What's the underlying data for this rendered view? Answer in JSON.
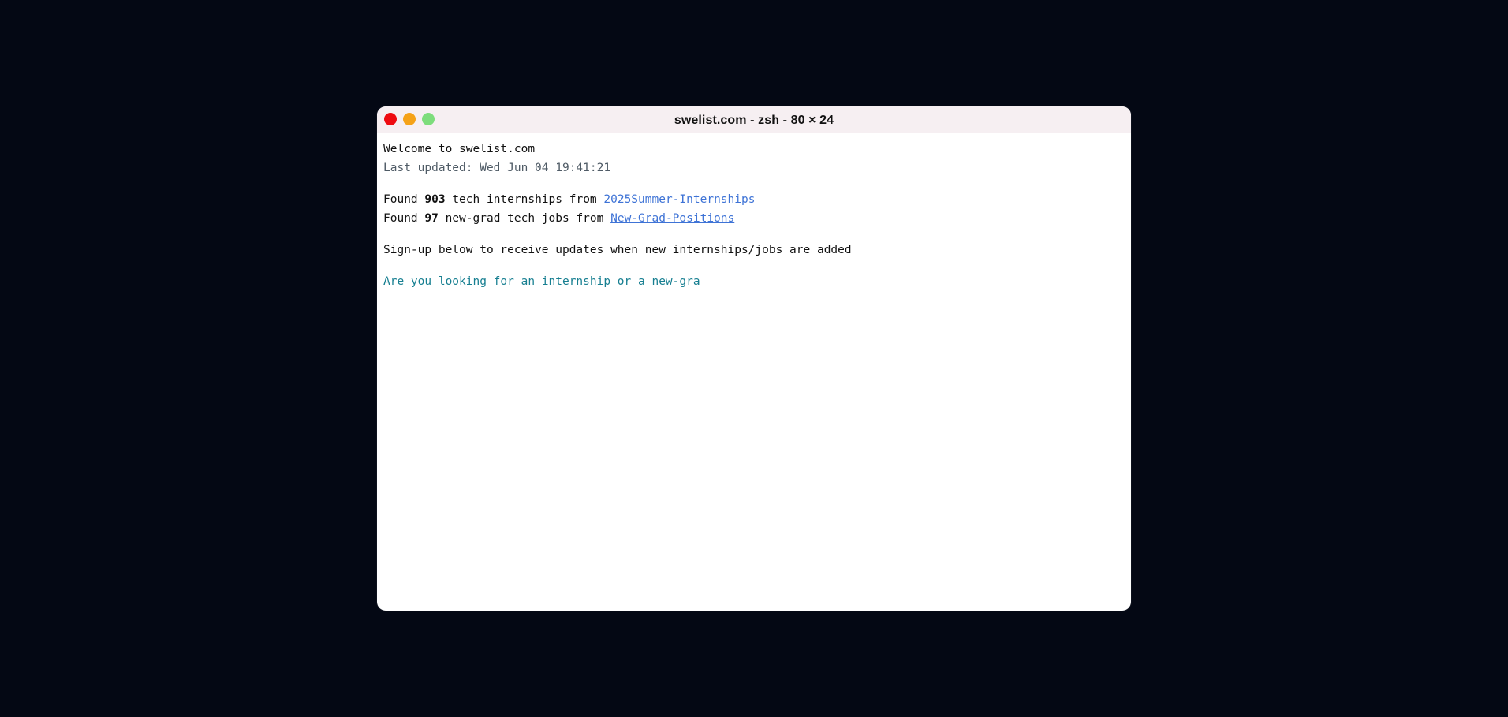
{
  "window": {
    "title": "swelist.com - zsh - 80 × 24"
  },
  "terminal": {
    "welcome": "Welcome to swelist.com",
    "last_updated": "Last updated: Wed Jun 04 19:41:21",
    "internships": {
      "prefix": "Found ",
      "count": "903",
      "middle": " tech internships from ",
      "link": "2025Summer-Internships"
    },
    "newgrad": {
      "prefix": "Found ",
      "count": "97",
      "middle": " new-grad tech jobs from ",
      "link": "New-Grad-Positions"
    },
    "signup": "Sign-up below to receive updates when new internships/jobs are added",
    "question": "Are you looking for an internship or a new-gra"
  },
  "colors": {
    "background": "#040814",
    "close": "#ee0b11",
    "minimize": "#f5a218",
    "maximize": "#7ddd7c",
    "link": "#3e73d6",
    "prompt": "#177f91"
  }
}
